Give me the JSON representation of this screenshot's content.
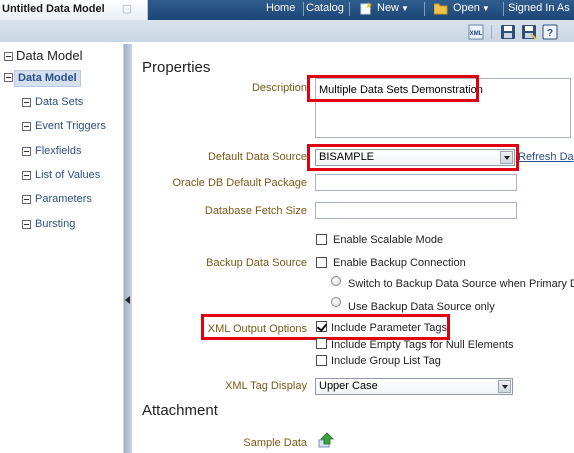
{
  "header": {
    "doc_title": "Untitled Data Model",
    "nav": {
      "home": "Home",
      "catalog": "Catalog",
      "new": "New",
      "open": "Open",
      "signed_in": "Signed In As"
    },
    "toolbar_icons": [
      "xml-icon",
      "save-icon",
      "save-as-icon",
      "help-icon"
    ]
  },
  "sidebar": {
    "title": "Data Model",
    "selected": "Data Model",
    "items": [
      {
        "label": "Data Sets"
      },
      {
        "label": "Event Triggers"
      },
      {
        "label": "Flexfields"
      },
      {
        "label": "List of Values"
      },
      {
        "label": "Parameters"
      },
      {
        "label": "Bursting"
      }
    ]
  },
  "properties": {
    "title": "Properties",
    "description_label": "Description",
    "description_value": "Multiple Data Sets Demonstration",
    "default_ds_label": "Default Data Source",
    "default_ds_value": "BISAMPLE",
    "refresh_link": "Refresh Da",
    "oracle_pkg_label": "Oracle DB Default Package",
    "oracle_pkg_value": "",
    "fetch_size_label": "Database Fetch Size",
    "fetch_size_value": "",
    "scalable_label": "Enable Scalable Mode",
    "scalable_checked": false,
    "backup_label": "Backup Data Source",
    "backup_enable_label": "Enable Backup Connection",
    "backup_enable_checked": false,
    "backup_radio1": "Switch to Backup Data Source when Primary D",
    "backup_radio2": "Use Backup Data Source only",
    "xml_options_label": "XML Output Options",
    "include_param_tags": "Include Parameter Tags",
    "include_param_checked": true,
    "include_empty_tags": "Include Empty Tags for Null Elements",
    "include_empty_checked": false,
    "include_group_list": "Include Group List Tag",
    "include_group_checked": false,
    "xml_tag_display_label": "XML Tag Display",
    "xml_tag_display_value": "Upper Case"
  },
  "attachment": {
    "title": "Attachment",
    "sample_data_label": "Sample Data",
    "upload_icon": "upload-icon"
  },
  "colors": {
    "accent_navy": "#1c4677",
    "label_brown": "#7a5a19",
    "link_blue": "#2b4f87",
    "highlight_red": "#e1000f"
  }
}
